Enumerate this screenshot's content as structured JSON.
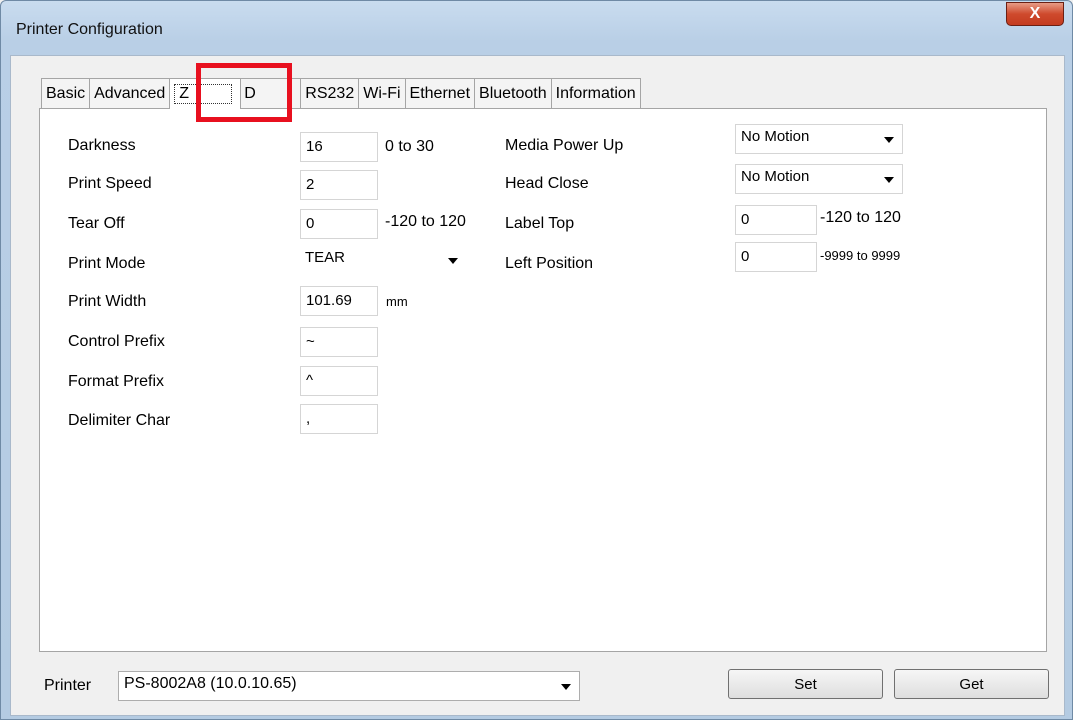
{
  "window": {
    "title": "Printer Configuration",
    "close_label": "X"
  },
  "tabs": [
    {
      "label": "Basic"
    },
    {
      "label": "Advanced"
    },
    {
      "label": "Z"
    },
    {
      "label": "D"
    },
    {
      "label": "RS232"
    },
    {
      "label": "Wi-Fi"
    },
    {
      "label": "Ethernet"
    },
    {
      "label": "Bluetooth"
    },
    {
      "label": "Information"
    }
  ],
  "left_fields": {
    "darkness": {
      "label": "Darkness",
      "value": "16",
      "hint": "0 to 30"
    },
    "print_speed": {
      "label": "Print Speed",
      "value": "2"
    },
    "tear_off": {
      "label": "Tear Off",
      "value": "0",
      "hint": "-120 to 120"
    },
    "print_mode": {
      "label": "Print Mode",
      "value": "TEAR"
    },
    "print_width": {
      "label": "Print Width",
      "value": "101.69",
      "hint": "mm"
    },
    "control_prefix": {
      "label": "Control Prefix",
      "value": "~"
    },
    "format_prefix": {
      "label": "Format Prefix",
      "value": "^"
    },
    "delimiter_char": {
      "label": "Delimiter Char",
      "value": ","
    }
  },
  "right_fields": {
    "media_power_up": {
      "label": "Media Power Up",
      "value": "No Motion"
    },
    "head_close": {
      "label": "Head Close",
      "value": "No Motion"
    },
    "label_top": {
      "label": "Label Top",
      "value": "0",
      "hint": "-120 to 120"
    },
    "left_position": {
      "label": "Left Position",
      "value": "0",
      "hint": "-9999 to 9999"
    }
  },
  "footer": {
    "printer_label": "Printer",
    "printer_value": "PS-8002A8 (10.0.10.65)",
    "set_label": "Set",
    "get_label": "Get"
  },
  "colors": {
    "highlight": "#e8101f",
    "title_bar": "#c9dcef",
    "close_button": "#cf4a2d"
  }
}
